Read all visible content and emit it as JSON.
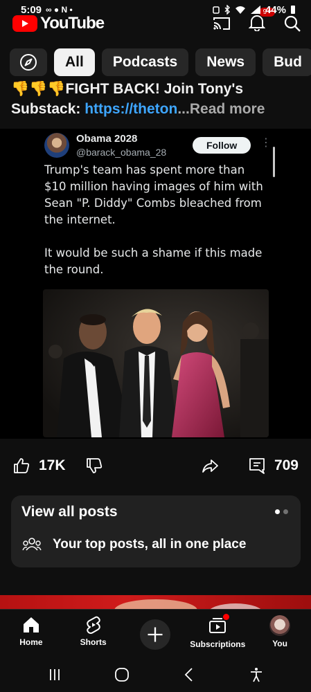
{
  "status_bar": {
    "time": "5:09",
    "left_icons": "∞ ● N •",
    "battery": "44%"
  },
  "app": {
    "name": "YouTube",
    "notification_count": "9+"
  },
  "chips": [
    {
      "label": "All",
      "active": true
    },
    {
      "label": "Podcasts",
      "active": false
    },
    {
      "label": "News",
      "active": false
    },
    {
      "label": "Bud",
      "active": false
    }
  ],
  "description": {
    "line1": "👎👎👎FIGHT BACK! Join Tony's",
    "prefix": "Substack: ",
    "link": "https://theton",
    "more": "...Read more"
  },
  "tweet": {
    "display_name": "Obama 2028",
    "handle": "@barack_obama_28",
    "follow_label": "Follow",
    "text": "Trump's team has spent more than\n$10 million having images of him with\nSean \"P. Diddy\" Combs bleached from\nthe internet.\n\nIt would be such a shame if this made\nthe round."
  },
  "actions": {
    "likes": "17K",
    "comments": "709"
  },
  "card": {
    "title": "View all posts",
    "subtitle": "Your top posts, all in one place"
  },
  "bottom_nav": [
    {
      "label": "Home"
    },
    {
      "label": "Shorts"
    },
    {
      "label": "Subscriptions"
    },
    {
      "label": "You"
    }
  ],
  "colors": {
    "brand_red": "#ff0000",
    "link_blue": "#3ea6ff",
    "background": "#0f0f0f",
    "chip_bg": "#272727"
  }
}
